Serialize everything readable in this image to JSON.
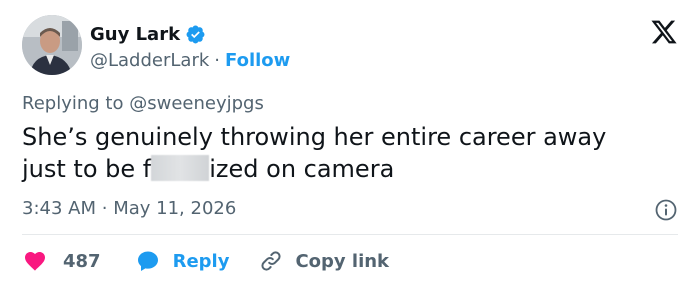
{
  "author": {
    "display_name": "Guy Lark",
    "handle": "@LadderLark",
    "separator": "·",
    "follow_label": "Follow",
    "verified": true
  },
  "reply_context": {
    "prefix": "Replying to",
    "mention": "@sweeneyjpgs"
  },
  "tweet": {
    "text_line1": "She’s genuinely throwing her entire career away",
    "text_line2_start": "just to be f",
    "text_line2_end": "ized on camera"
  },
  "meta": {
    "time": "3:43 AM",
    "separator": "·",
    "date": "May 11, 2026"
  },
  "actions": {
    "like_count": "487",
    "reply_label": "Reply",
    "copy_link_label": "Copy link"
  },
  "colors": {
    "accent": "#1d9bf0",
    "like": "#f91880",
    "muted": "#536471",
    "text": "#0f1419"
  },
  "icons": {
    "verified": "verified-badge-icon",
    "x_logo": "x-logo-icon",
    "info": "info-icon",
    "like": "heart-icon",
    "reply": "speech-bubble-icon",
    "copy": "link-icon"
  }
}
